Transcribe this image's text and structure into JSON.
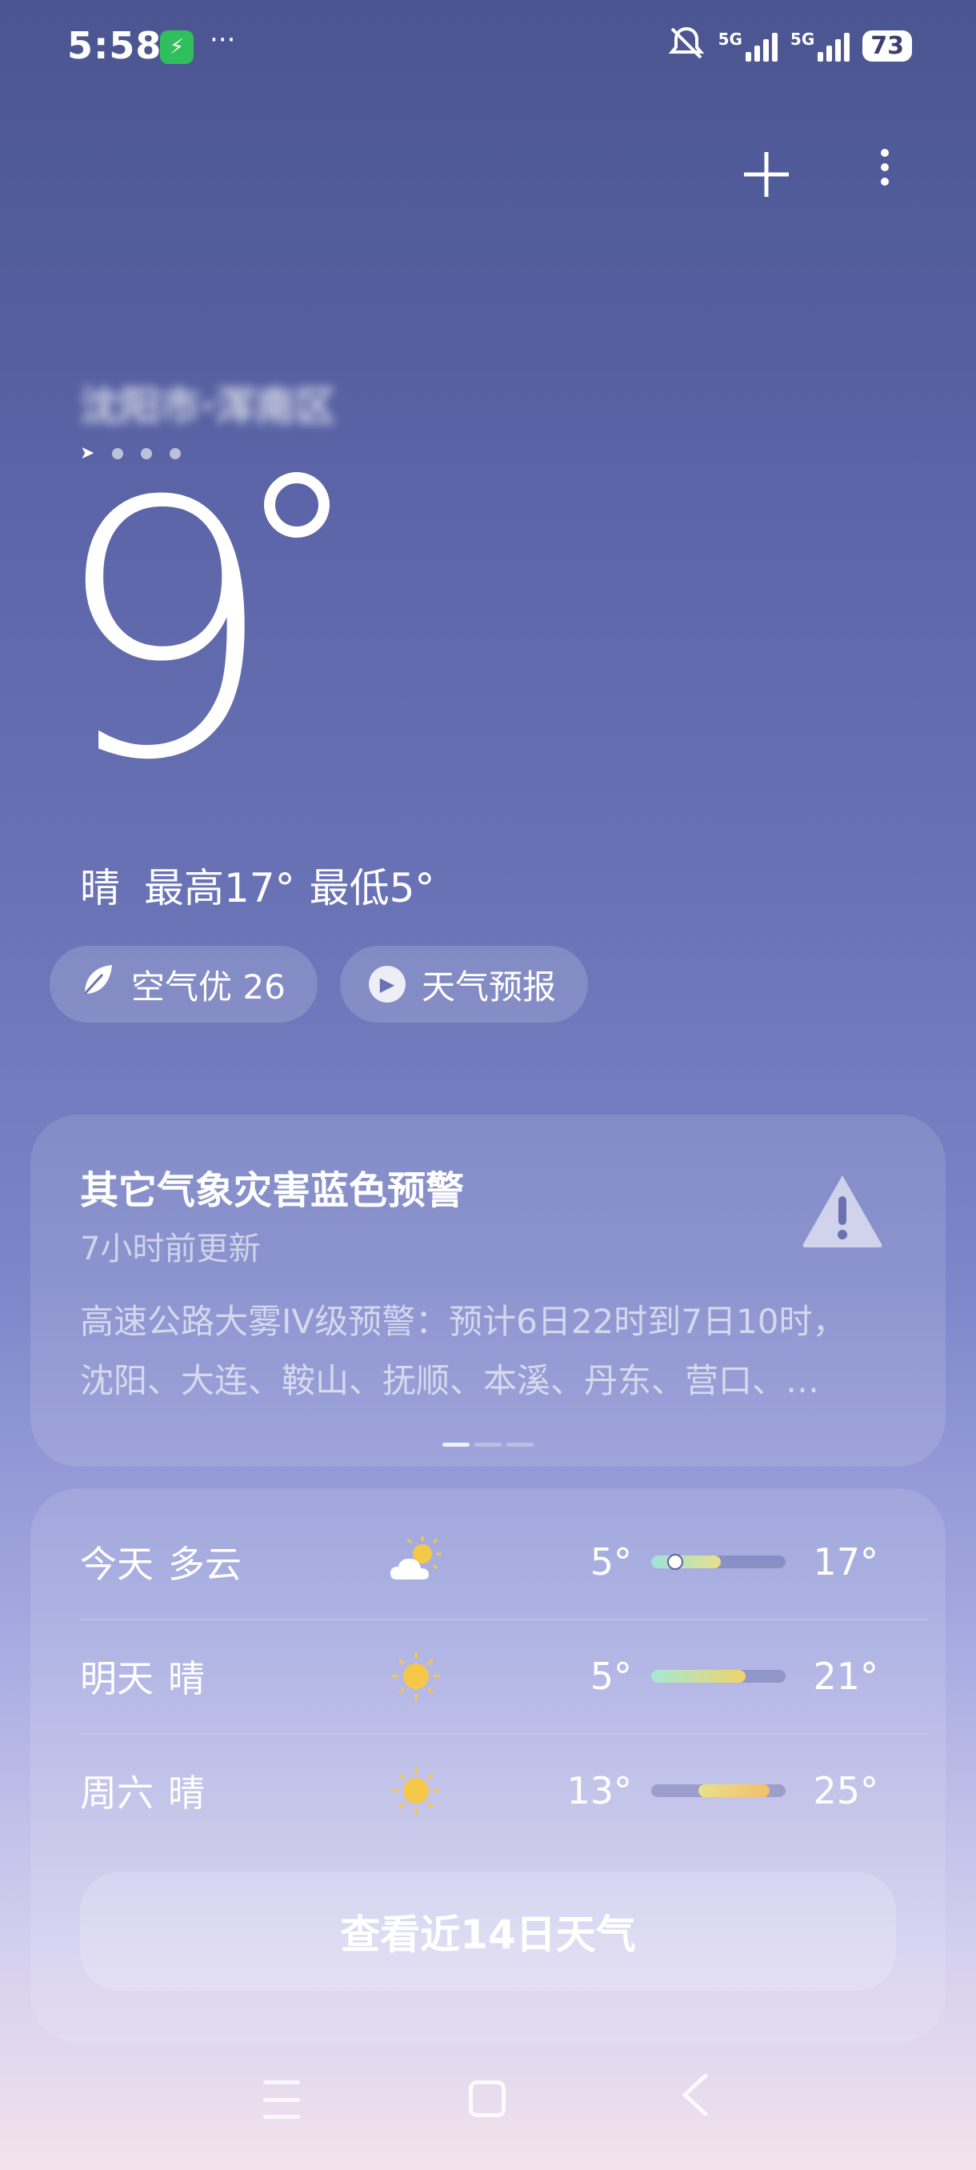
{
  "status_bar": {
    "time": "5:58",
    "more": "···",
    "net1": "5G",
    "net2": "5G",
    "battery": "73"
  },
  "header": {
    "location": "沈阳市·浑南区",
    "page_count": 4
  },
  "current": {
    "temp": "9",
    "condition": "晴",
    "high": "最高17°",
    "low": "最低5°"
  },
  "pills": {
    "air_quality": "空气优 26",
    "forecast_video": "天气预报"
  },
  "warning": {
    "title": "其它气象灾害蓝色预警",
    "updated": "7小时前更新",
    "body_line1": "高速公路大雾IV级预警：预计6日22时到7日10时，",
    "body_line2": "沈阳、大连、鞍山、抚顺、本溪、丹东、营口、…"
  },
  "forecast": {
    "days": [
      {
        "day": "今天",
        "cond": "多云",
        "icon": "partly-cloudy-icon",
        "low": "5°",
        "high": "17°",
        "bar_start": 0.0,
        "bar_end": 0.52,
        "now": 0.18,
        "color_a": "#9fe3d9",
        "color_b": "#e7e08c"
      },
      {
        "day": "明天",
        "cond": "晴",
        "icon": "sun-icon",
        "low": "5°",
        "high": "21°",
        "bar_start": 0.0,
        "bar_end": 0.7,
        "color_a": "#a6e8d4",
        "color_b": "#f0d36a"
      },
      {
        "day": "周六",
        "cond": "晴",
        "icon": "sun-icon",
        "low": "13°",
        "high": "25°",
        "bar_start": 0.35,
        "bar_end": 0.88,
        "color_a": "#e9e18c",
        "color_b": "#f5be6a"
      }
    ],
    "more_button": "查看近14日天气"
  }
}
